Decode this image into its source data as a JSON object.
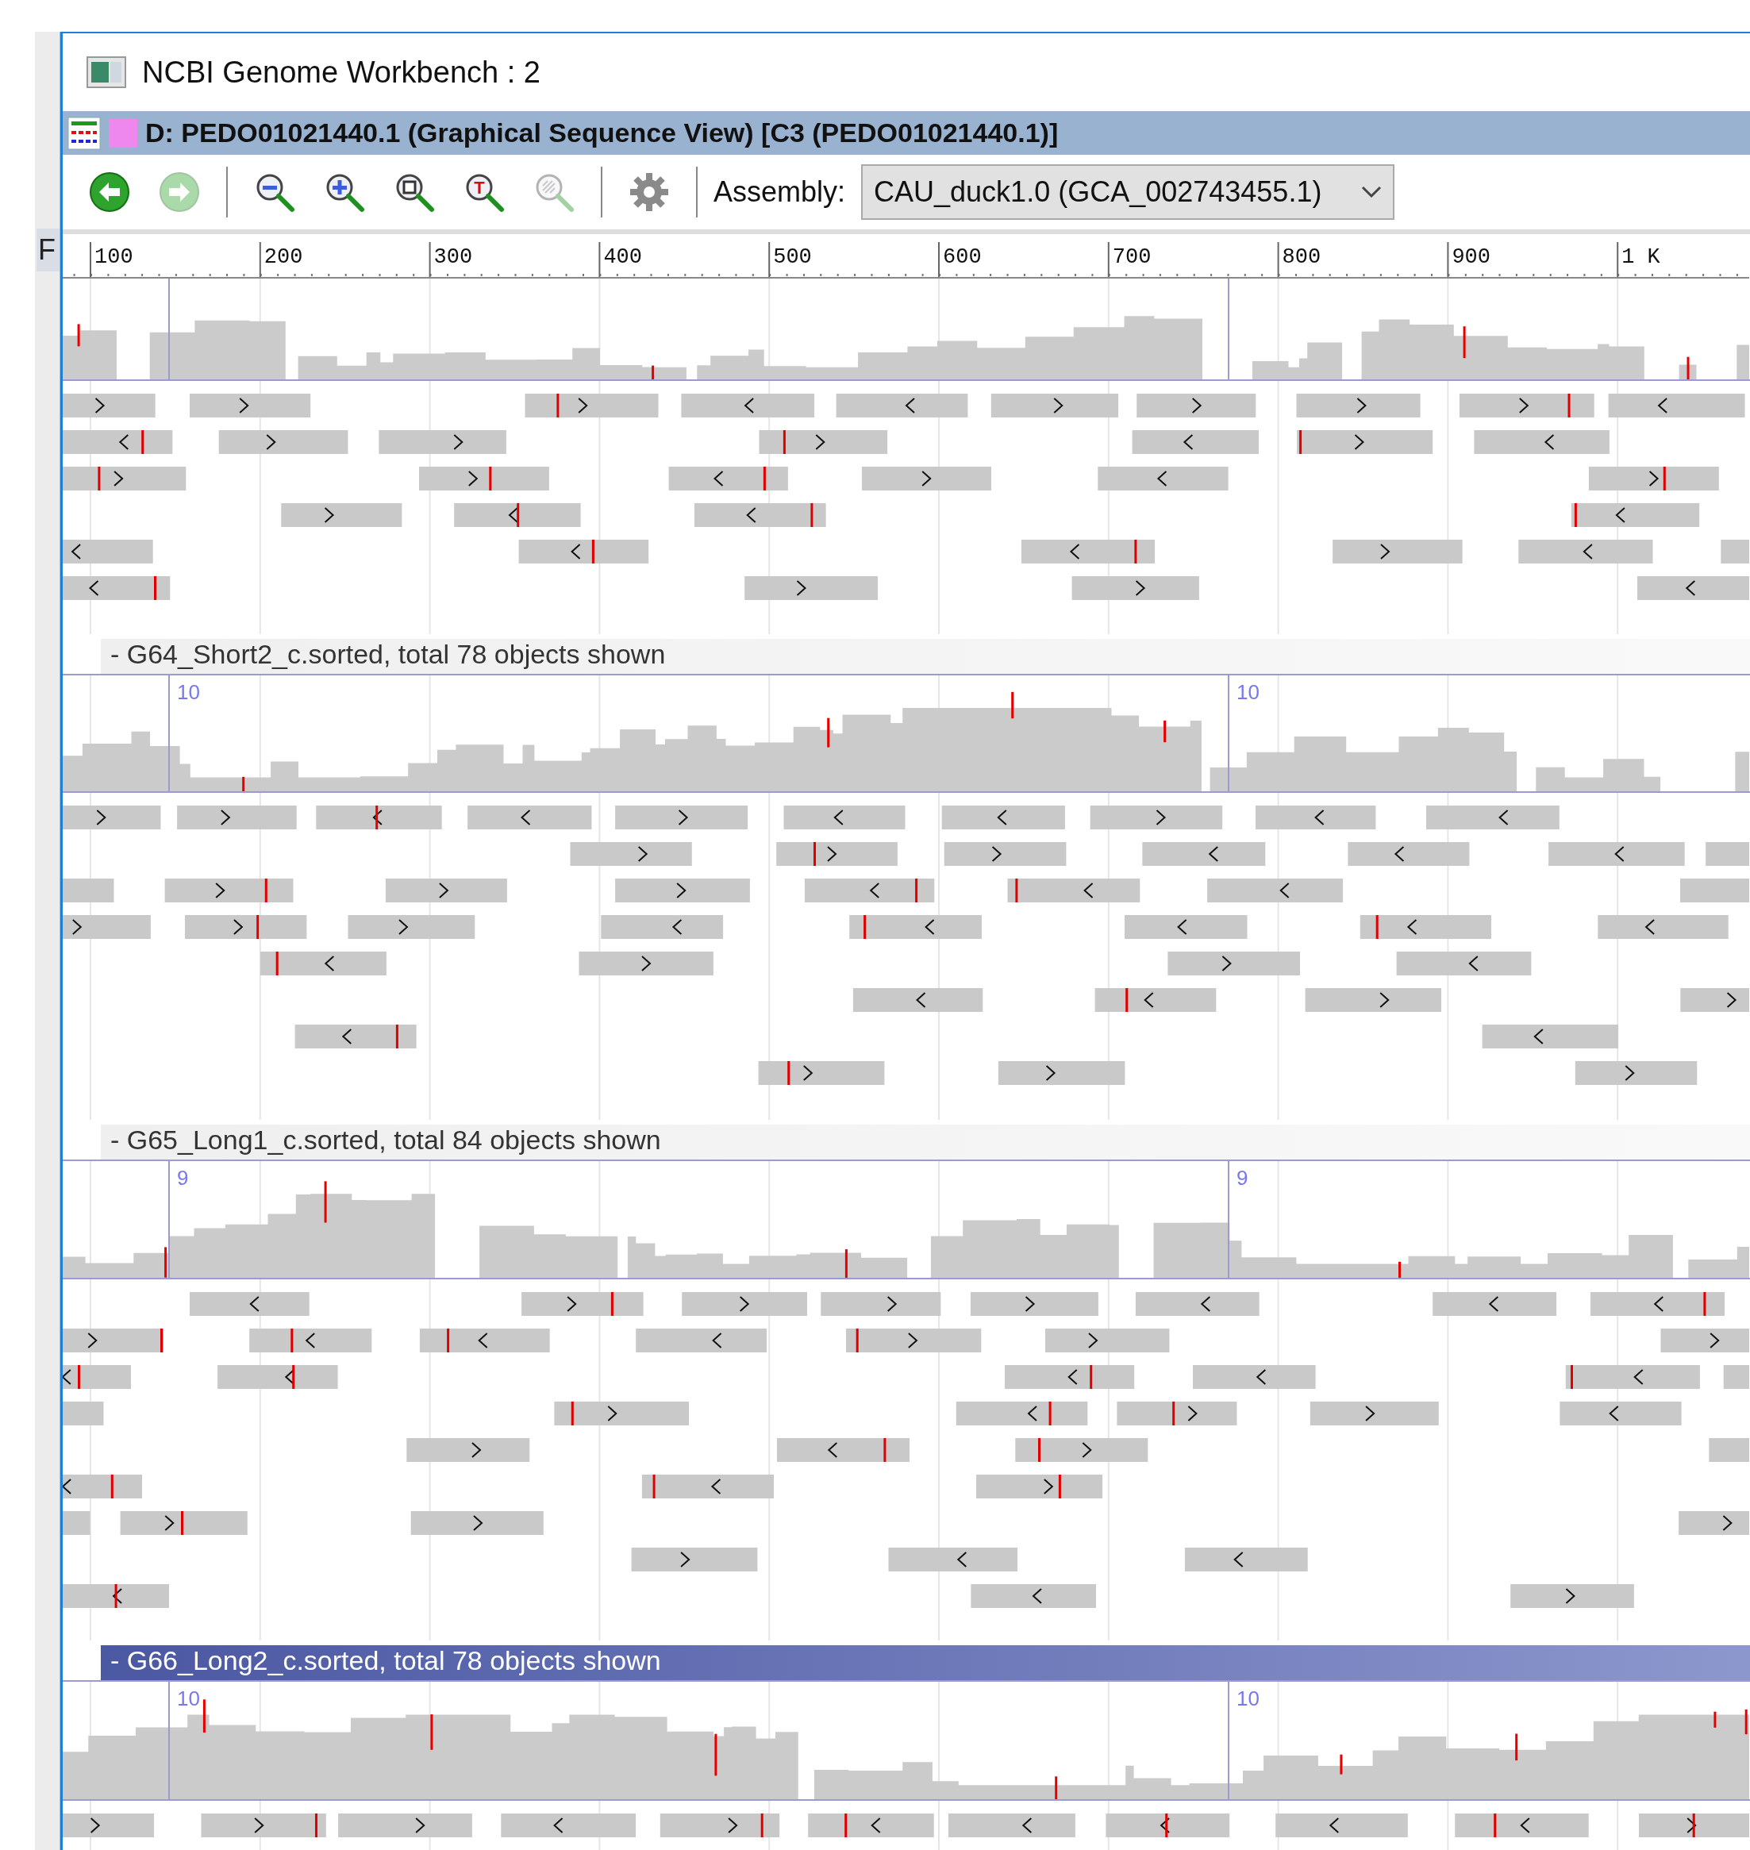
{
  "background_window": {
    "text": "F"
  },
  "window": {
    "title": "NCBI Genome Workbench : 2"
  },
  "view_tab": {
    "title": "D: PEDO01021440.1 (Graphical Sequence View) [C3 (PEDO01021440.1)]"
  },
  "toolbar": {
    "buttons": [
      {
        "kind": "back",
        "disabled": false
      },
      {
        "kind": "forward",
        "disabled": true
      },
      {
        "kind": "zoom_out",
        "disabled": false
      },
      {
        "kind": "zoom_in",
        "disabled": false
      },
      {
        "kind": "zoom_selection",
        "disabled": false
      },
      {
        "kind": "zoom_sequence",
        "disabled": false,
        "glyph": "T"
      },
      {
        "kind": "zoom_pattern",
        "disabled": true
      },
      {
        "kind": "settings",
        "disabled": false
      }
    ],
    "assembly_label": "Assembly:",
    "assembly": "CAU_duck1.0 (GCA_002743455.1)"
  },
  "ruler": {
    "ticks": [
      "100",
      "200",
      "300",
      "400",
      "500",
      "600",
      "700",
      "800",
      "900",
      "1 K"
    ]
  },
  "tracks": [
    {
      "kind": "partial"
    },
    {
      "kind": "alignment",
      "title": "- G64_Short2_c.sorted, total 78 objects shown",
      "selected": false,
      "max_labels": [
        "10",
        "10"
      ]
    },
    {
      "kind": "alignment",
      "title": "- G65_Long1_c.sorted, total 84 objects shown",
      "selected": false,
      "max_labels": [
        "9",
        "9"
      ]
    },
    {
      "kind": "alignment",
      "title": "- G66_Long2_c.sorted, total 78 objects shown",
      "selected": true,
      "max_labels": [
        "10",
        "10"
      ]
    }
  ]
}
